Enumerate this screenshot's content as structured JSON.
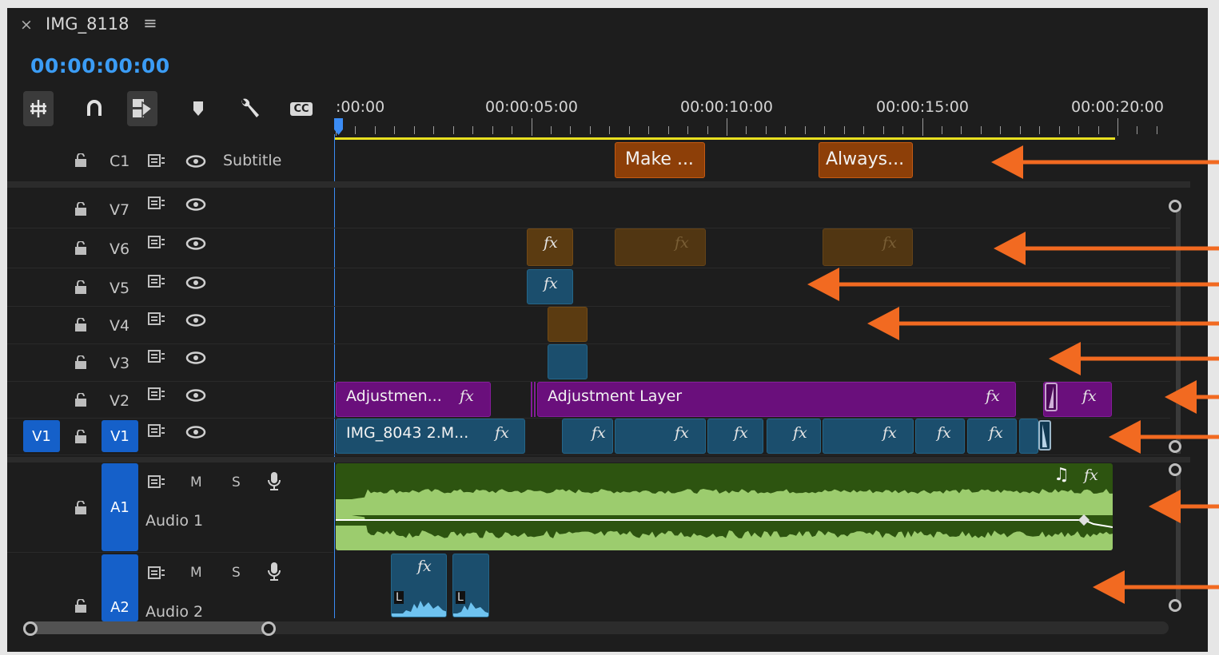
{
  "sequence": {
    "close_glyph": "×",
    "name": "IMG_8118",
    "menu_glyph": "≡",
    "timecode": "00:00:00:00"
  },
  "toolbar": {
    "tools": [
      {
        "name": "insert-sequence-as-nest",
        "on": true
      },
      {
        "name": "snap",
        "on": false
      },
      {
        "name": "linked-selection",
        "on": true
      },
      {
        "name": "add-marker",
        "on": false
      },
      {
        "name": "timeline-settings",
        "on": false
      },
      {
        "name": "captions",
        "label": "CC",
        "on": false
      }
    ]
  },
  "ruler": {
    "labels": [
      ":00:00",
      "00:00:05:00",
      "00:00:10:00",
      "00:00:15:00",
      "00:00:20:00"
    ]
  },
  "tracks": {
    "subtitle": {
      "name": "C1",
      "label": "Subtitle"
    },
    "video": [
      {
        "name": "V7"
      },
      {
        "name": "V6"
      },
      {
        "name": "V5"
      },
      {
        "name": "V4"
      },
      {
        "name": "V3"
      },
      {
        "name": "V2"
      },
      {
        "name": "V1",
        "source_patch": "V1"
      }
    ],
    "audio": [
      {
        "name": "A1",
        "label": "Audio 1",
        "m": "M",
        "s": "S"
      },
      {
        "name": "A2",
        "label": "Audio 2",
        "m": "M",
        "s": "S"
      }
    ]
  },
  "clips": {
    "caption_1": "Make ...",
    "caption_2": "Always...",
    "adj_1": "Adjustmen...",
    "adj_2": "Adjustment Layer",
    "v1_first": "IMG_8043 2.M...",
    "fx": "fx",
    "music_note": "♫",
    "audio_channel": "L"
  },
  "colors": {
    "timecode": "#3b9cf5",
    "track_target": "#1560c9",
    "caption_clip": "#8d3f08",
    "video_clip_blue": "#1b4e6d",
    "video_clip_brown": "#5b3b11",
    "adjustment_layer": "#6a0f7c",
    "audio_clip": "#2d5410",
    "waveform": "#9ccc6e",
    "work_area_bar": "#e8e020",
    "annotation_arrow": "#f26a21"
  }
}
